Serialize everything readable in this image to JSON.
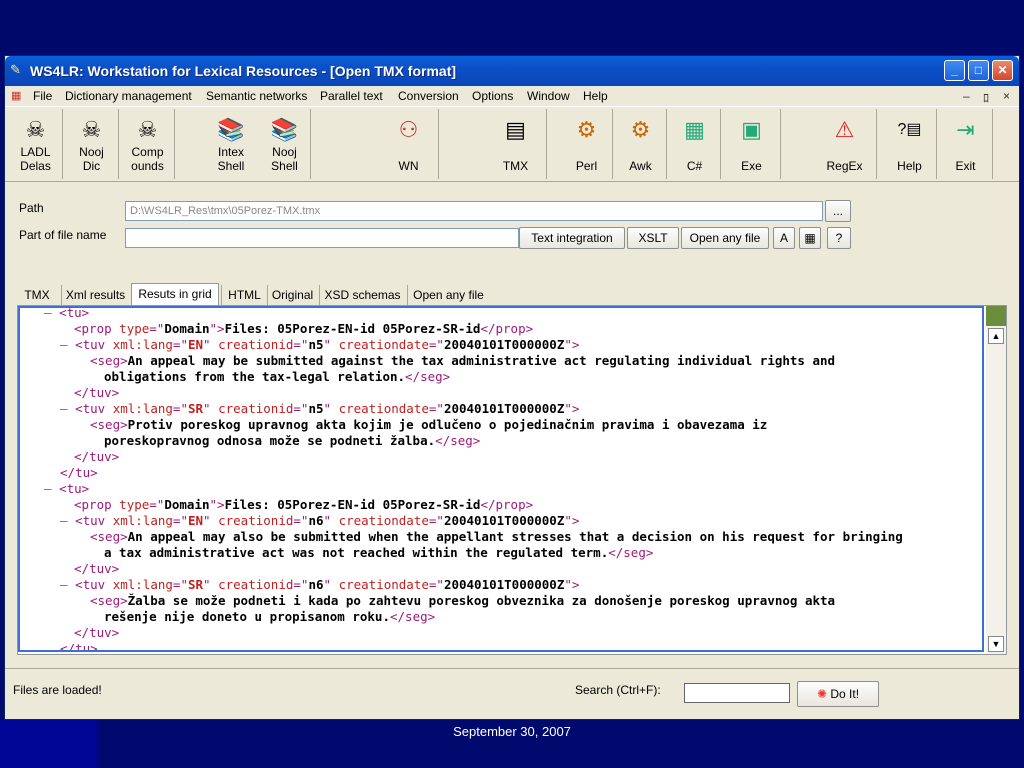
{
  "window": {
    "title": "WS4LR: Workstation for Lexical Resources - [Open TMX format]",
    "controls": {
      "minimize": "_",
      "maximize": "□",
      "close": "✕"
    }
  },
  "menu": {
    "items": [
      "File",
      "Dictionary management",
      "Semantic networks",
      "Parallel text",
      "Conversion",
      "Options",
      "Window",
      "Help"
    ],
    "mdi": [
      "–",
      "ﾛ",
      "×"
    ]
  },
  "toolbar": {
    "buttons": [
      {
        "label": "LADL\nDelas",
        "icon": "skull-icon"
      },
      {
        "label": "Nooj\nDic",
        "icon": "skull-icon"
      },
      {
        "label": "Comp\nounds",
        "icon": "skull-icon"
      },
      {
        "label": "Intex\nShell",
        "icon": "book-icon"
      },
      {
        "label": "Nooj\nShell",
        "icon": "book-icon"
      },
      {
        "label": "WN",
        "icon": "network-icon"
      },
      {
        "label": "TMX",
        "icon": "document-icon"
      },
      {
        "label": "Perl",
        "icon": "perl-icon"
      },
      {
        "label": "Awk",
        "icon": "awk-icon"
      },
      {
        "label": "C#",
        "icon": "csharp-icon"
      },
      {
        "label": "Exe",
        "icon": "exe-icon"
      },
      {
        "label": "RegEx",
        "icon": "regex-icon"
      },
      {
        "label": "Help",
        "icon": "help-icon"
      },
      {
        "label": "Exit",
        "icon": "exit-icon"
      }
    ]
  },
  "path": {
    "label": "Path",
    "value": "D:\\WS4LR_Res\\tmx\\05Porez-TMX.tmx",
    "browse": "...",
    "part_label": "Part of file name",
    "part_value": "",
    "text_integration": "Text integration",
    "xslt": "XSLT",
    "open_any": "Open any file"
  },
  "tabs": [
    "TMX",
    "Xml results",
    "Resuts in grid",
    "HTML",
    "Original",
    "XSD schemas",
    "Open any file"
  ],
  "active_tab": "Resuts in grid",
  "xml": {
    "tu": "tu",
    "prop_tag": "prop",
    "type_attr": "type",
    "domain_val": "Domain",
    "files_text": "Files: 05Porez-EN-id 05Porez-SR-id",
    "tuv_tag": "tuv",
    "lang_attr": "xml:lang",
    "en": "EN",
    "sr": "SR",
    "cid_attr": "creationid",
    "cdate_attr": "creationdate",
    "n5": "n5",
    "n6": "n6",
    "date_val": "20040101T000000Z",
    "seg_tag": "seg",
    "seg1_en_a": "An appeal may be submitted against the tax administrative act regulating individual rights and",
    "seg1_en_b": "obligations from the tax-legal relation.",
    "seg1_sr_a": "Protiv poreskog upravnog akta kojim je odlučeno o pojedinačnim pravima i obavezama iz",
    "seg1_sr_b": "poreskopravnog odnosa može se podneti žalba.",
    "seg2_en_a": "An appeal may also be submitted when the appellant stresses that a decision on his request for bringing",
    "seg2_en_b": "a tax administrative act was not reached within the regulated term.",
    "seg2_sr_a": "Žalba se može podneti i kada po zahtevu poreskog obveznika za donošenje poreskog upravnog akta",
    "seg2_sr_b": "rešenje nije doneto u propisanom roku."
  },
  "status": {
    "message": "Files are loaded!",
    "search_label": "Search (Ctrl+F):",
    "search_value": "",
    "do_it": "Do It!"
  },
  "footer": {
    "date": "September 30, 2007"
  }
}
